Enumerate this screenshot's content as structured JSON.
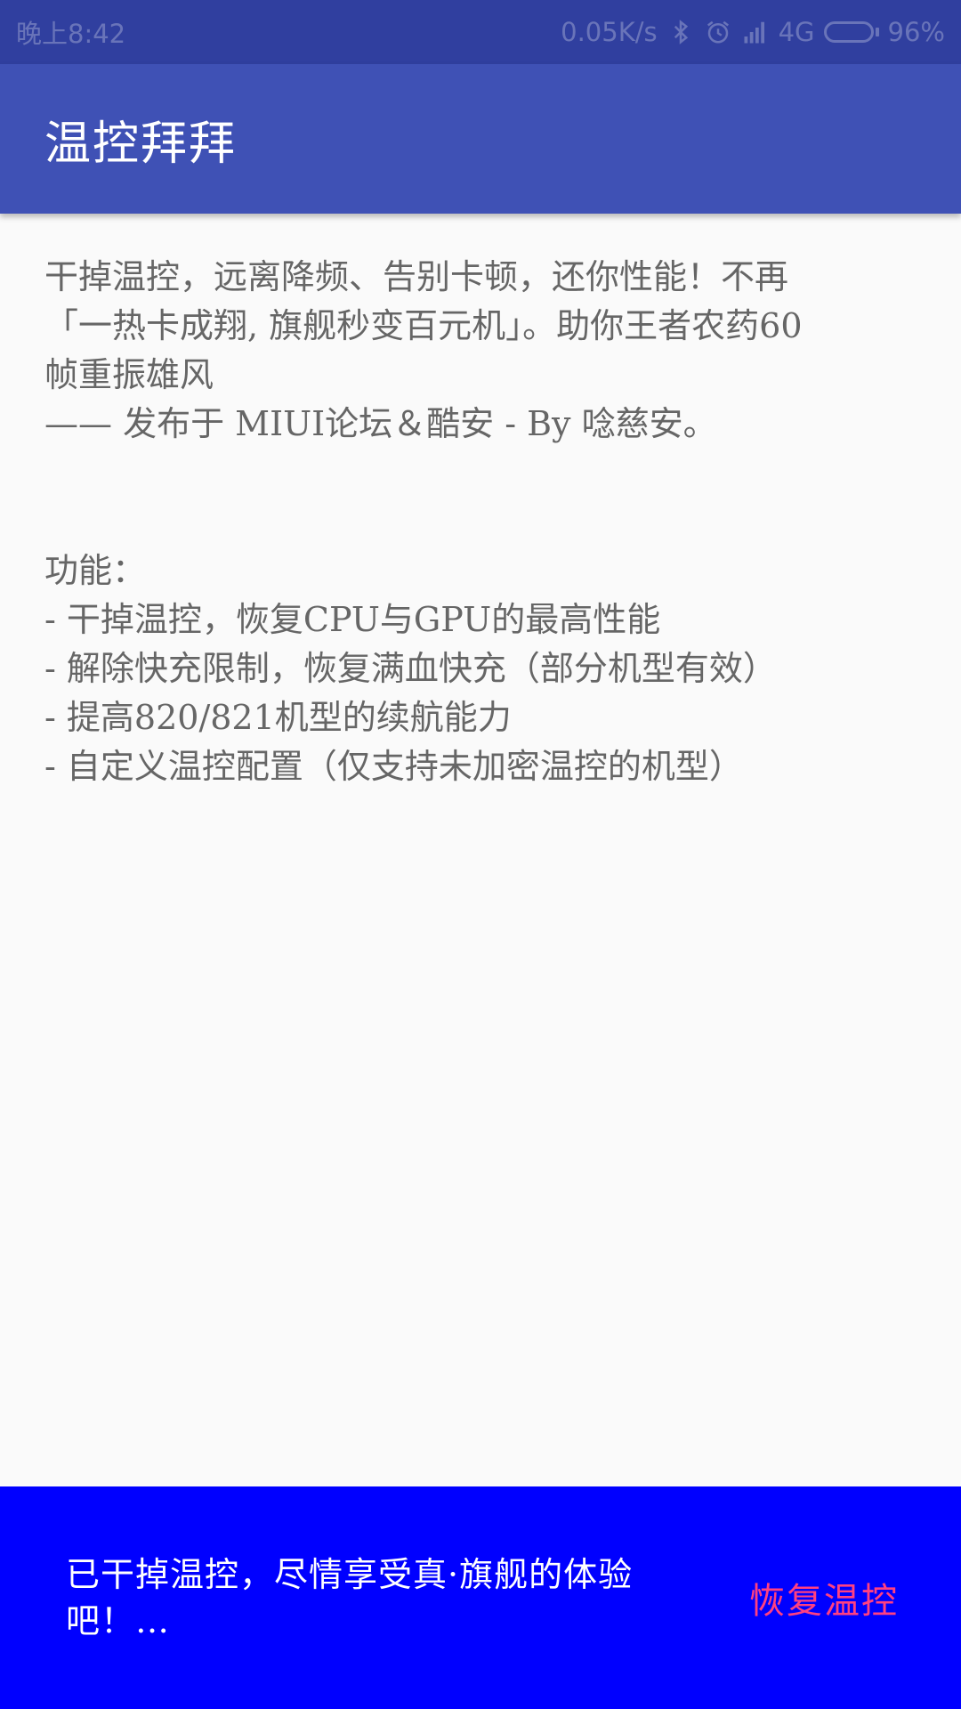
{
  "status_bar": {
    "time": "晚上8:42",
    "net_speed": "0.05K/s",
    "network": "4G",
    "battery": "96%",
    "battery_level": 0.96,
    "icons": [
      "bluetooth-icon",
      "alarm-icon",
      "signal-icon",
      "battery-icon"
    ]
  },
  "app_bar": {
    "title": "温控拜拜",
    "color": "#3f51b5"
  },
  "content": {
    "intro_line1": "干掉温控，远离降频、告别卡顿，还你性能！不再",
    "intro_line2": "「一热卡成翔, 旗舰秒变百元机」。助你王者农药60",
    "intro_line3": "帧重振雄风",
    "credit": "—— 发布于 MIUI论坛＆酷安 - By 唸慈安。",
    "features_heading": "功能：",
    "features": [
      "- 干掉温控，恢复CPU与GPU的最高性能",
      "- 解除快充限制，恢复满血快充（部分机型有效）",
      "- 提高820/821机型的续航能力",
      "- 自定义温控配置（仅支持未加密温控的机型）"
    ]
  },
  "snackbar": {
    "message": "已干掉温控，尽情享受真·旗舰的体验吧！…",
    "action_label": "恢复温控",
    "background": "#0000ff",
    "action_color": "#ff4081"
  }
}
